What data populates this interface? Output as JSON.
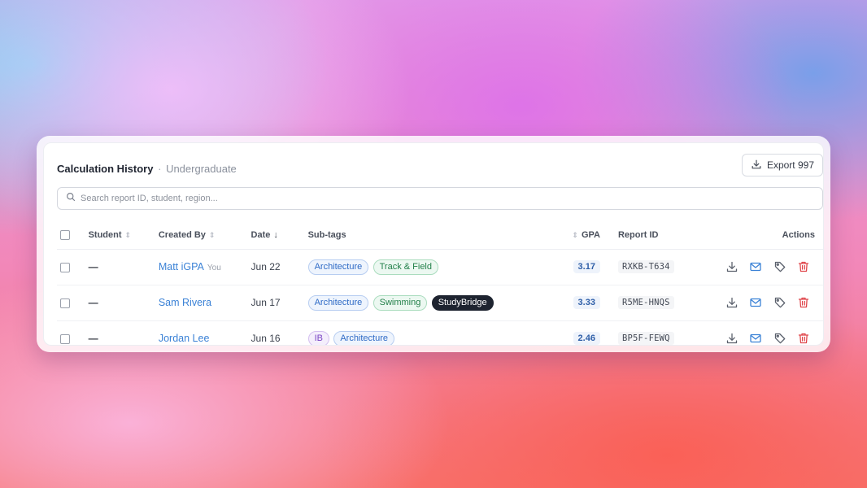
{
  "header": {
    "title": "Calculation History",
    "separator": "·",
    "subtitle": "Undergraduate",
    "export_label": "Export 997"
  },
  "search": {
    "placeholder": "Search report ID, student, region..."
  },
  "columns": {
    "student": "Student",
    "created_by": "Created By",
    "date": "Date",
    "subtags": "Sub-tags",
    "gpa": "GPA",
    "report_id": "Report ID",
    "actions": "Actions"
  },
  "rows": [
    {
      "student": "—",
      "created_by": "Matt iGPA",
      "you_label": "You",
      "date": "Jun 22",
      "tags": [
        {
          "label": "Architecture",
          "style": "blue"
        },
        {
          "label": "Track & Field",
          "style": "green"
        }
      ],
      "gpa": "3.17",
      "report_id": "RXKB-T634"
    },
    {
      "student": "—",
      "created_by": "Sam Rivera",
      "date": "Jun 17",
      "tags": [
        {
          "label": "Architecture",
          "style": "blue"
        },
        {
          "label": "Swimming",
          "style": "green"
        },
        {
          "label": "StudyBridge",
          "style": "dark"
        }
      ],
      "gpa": "3.33",
      "report_id": "R5ME-HNQS"
    },
    {
      "student": "—",
      "created_by": "Jordan Lee",
      "date": "Jun 16",
      "tags": [
        {
          "label": "IB",
          "style": "purple"
        },
        {
          "label": "Architecture",
          "style": "blue"
        }
      ],
      "gpa": "2.46",
      "report_id": "BP5F-FEWQ"
    }
  ],
  "icons": {
    "row_actions": [
      "download-icon",
      "mail-icon",
      "tag-icon",
      "trash-icon"
    ]
  },
  "colors": {
    "link": "#3b82d6",
    "delete": "#e0474c",
    "mail": "#3b82d6"
  }
}
